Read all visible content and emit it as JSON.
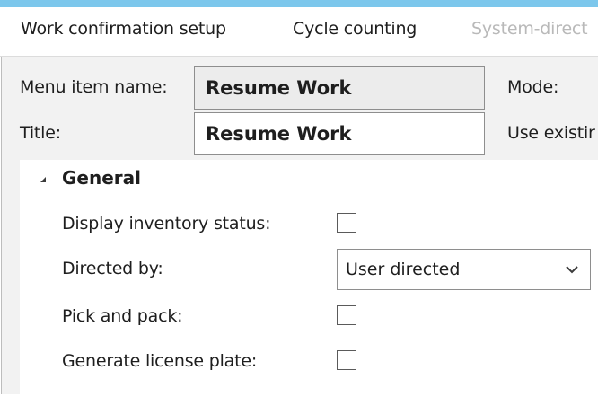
{
  "tabs": [
    {
      "label": "Work confirmation setup"
    },
    {
      "label": "Cycle counting"
    },
    {
      "label": "System-direct"
    }
  ],
  "header": {
    "menu_item_name_label": "Menu item name:",
    "menu_item_name_value": "Resume Work",
    "title_label": "Title:",
    "title_value": "Resume Work",
    "mode_label": "Mode:",
    "use_existing_label": "Use existir"
  },
  "general": {
    "group_label": "General",
    "fields": [
      {
        "label": "Display inventory status:",
        "type": "checkbox",
        "checked": false
      },
      {
        "label": "Directed by:",
        "type": "select",
        "value": "User directed"
      },
      {
        "label": "Pick and pack:",
        "type": "checkbox",
        "checked": false
      },
      {
        "label": "Generate license plate:",
        "type": "checkbox",
        "checked": false
      }
    ]
  },
  "colors": {
    "top_accent": "#7cc7ec",
    "frame_bg": "#f2f2f2",
    "disabled_tab": "#b9b9b9"
  },
  "icons": {
    "group_toggle": "collapse-triangle-icon",
    "dropdown": "chevron-down-icon"
  }
}
